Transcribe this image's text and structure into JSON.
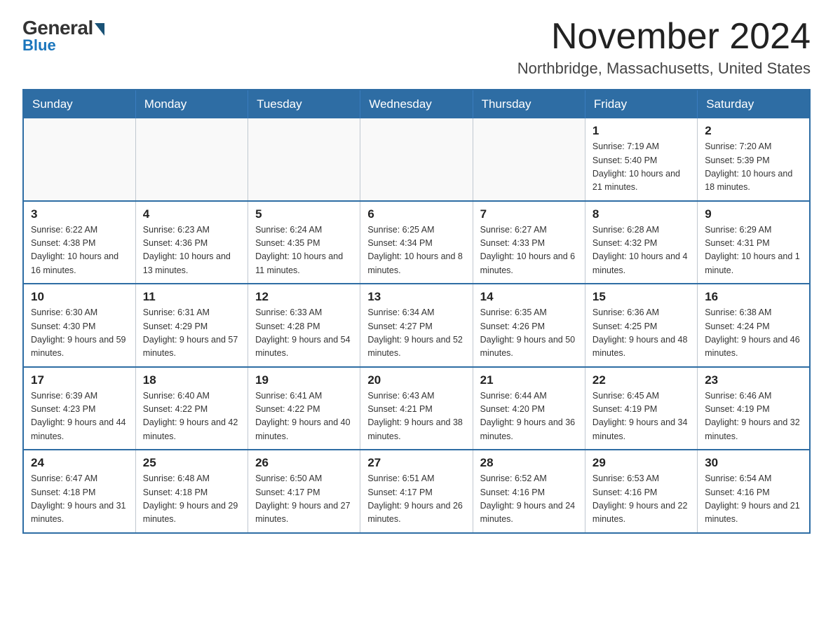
{
  "logo": {
    "general": "General",
    "blue": "Blue"
  },
  "header": {
    "month": "November 2024",
    "location": "Northbridge, Massachusetts, United States"
  },
  "weekdays": [
    "Sunday",
    "Monday",
    "Tuesday",
    "Wednesday",
    "Thursday",
    "Friday",
    "Saturday"
  ],
  "weeks": [
    [
      {
        "day": "",
        "info": ""
      },
      {
        "day": "",
        "info": ""
      },
      {
        "day": "",
        "info": ""
      },
      {
        "day": "",
        "info": ""
      },
      {
        "day": "",
        "info": ""
      },
      {
        "day": "1",
        "info": "Sunrise: 7:19 AM\nSunset: 5:40 PM\nDaylight: 10 hours and 21 minutes."
      },
      {
        "day": "2",
        "info": "Sunrise: 7:20 AM\nSunset: 5:39 PM\nDaylight: 10 hours and 18 minutes."
      }
    ],
    [
      {
        "day": "3",
        "info": "Sunrise: 6:22 AM\nSunset: 4:38 PM\nDaylight: 10 hours and 16 minutes."
      },
      {
        "day": "4",
        "info": "Sunrise: 6:23 AM\nSunset: 4:36 PM\nDaylight: 10 hours and 13 minutes."
      },
      {
        "day": "5",
        "info": "Sunrise: 6:24 AM\nSunset: 4:35 PM\nDaylight: 10 hours and 11 minutes."
      },
      {
        "day": "6",
        "info": "Sunrise: 6:25 AM\nSunset: 4:34 PM\nDaylight: 10 hours and 8 minutes."
      },
      {
        "day": "7",
        "info": "Sunrise: 6:27 AM\nSunset: 4:33 PM\nDaylight: 10 hours and 6 minutes."
      },
      {
        "day": "8",
        "info": "Sunrise: 6:28 AM\nSunset: 4:32 PM\nDaylight: 10 hours and 4 minutes."
      },
      {
        "day": "9",
        "info": "Sunrise: 6:29 AM\nSunset: 4:31 PM\nDaylight: 10 hours and 1 minute."
      }
    ],
    [
      {
        "day": "10",
        "info": "Sunrise: 6:30 AM\nSunset: 4:30 PM\nDaylight: 9 hours and 59 minutes."
      },
      {
        "day": "11",
        "info": "Sunrise: 6:31 AM\nSunset: 4:29 PM\nDaylight: 9 hours and 57 minutes."
      },
      {
        "day": "12",
        "info": "Sunrise: 6:33 AM\nSunset: 4:28 PM\nDaylight: 9 hours and 54 minutes."
      },
      {
        "day": "13",
        "info": "Sunrise: 6:34 AM\nSunset: 4:27 PM\nDaylight: 9 hours and 52 minutes."
      },
      {
        "day": "14",
        "info": "Sunrise: 6:35 AM\nSunset: 4:26 PM\nDaylight: 9 hours and 50 minutes."
      },
      {
        "day": "15",
        "info": "Sunrise: 6:36 AM\nSunset: 4:25 PM\nDaylight: 9 hours and 48 minutes."
      },
      {
        "day": "16",
        "info": "Sunrise: 6:38 AM\nSunset: 4:24 PM\nDaylight: 9 hours and 46 minutes."
      }
    ],
    [
      {
        "day": "17",
        "info": "Sunrise: 6:39 AM\nSunset: 4:23 PM\nDaylight: 9 hours and 44 minutes."
      },
      {
        "day": "18",
        "info": "Sunrise: 6:40 AM\nSunset: 4:22 PM\nDaylight: 9 hours and 42 minutes."
      },
      {
        "day": "19",
        "info": "Sunrise: 6:41 AM\nSunset: 4:22 PM\nDaylight: 9 hours and 40 minutes."
      },
      {
        "day": "20",
        "info": "Sunrise: 6:43 AM\nSunset: 4:21 PM\nDaylight: 9 hours and 38 minutes."
      },
      {
        "day": "21",
        "info": "Sunrise: 6:44 AM\nSunset: 4:20 PM\nDaylight: 9 hours and 36 minutes."
      },
      {
        "day": "22",
        "info": "Sunrise: 6:45 AM\nSunset: 4:19 PM\nDaylight: 9 hours and 34 minutes."
      },
      {
        "day": "23",
        "info": "Sunrise: 6:46 AM\nSunset: 4:19 PM\nDaylight: 9 hours and 32 minutes."
      }
    ],
    [
      {
        "day": "24",
        "info": "Sunrise: 6:47 AM\nSunset: 4:18 PM\nDaylight: 9 hours and 31 minutes."
      },
      {
        "day": "25",
        "info": "Sunrise: 6:48 AM\nSunset: 4:18 PM\nDaylight: 9 hours and 29 minutes."
      },
      {
        "day": "26",
        "info": "Sunrise: 6:50 AM\nSunset: 4:17 PM\nDaylight: 9 hours and 27 minutes."
      },
      {
        "day": "27",
        "info": "Sunrise: 6:51 AM\nSunset: 4:17 PM\nDaylight: 9 hours and 26 minutes."
      },
      {
        "day": "28",
        "info": "Sunrise: 6:52 AM\nSunset: 4:16 PM\nDaylight: 9 hours and 24 minutes."
      },
      {
        "day": "29",
        "info": "Sunrise: 6:53 AM\nSunset: 4:16 PM\nDaylight: 9 hours and 22 minutes."
      },
      {
        "day": "30",
        "info": "Sunrise: 6:54 AM\nSunset: 4:16 PM\nDaylight: 9 hours and 21 minutes."
      }
    ]
  ]
}
